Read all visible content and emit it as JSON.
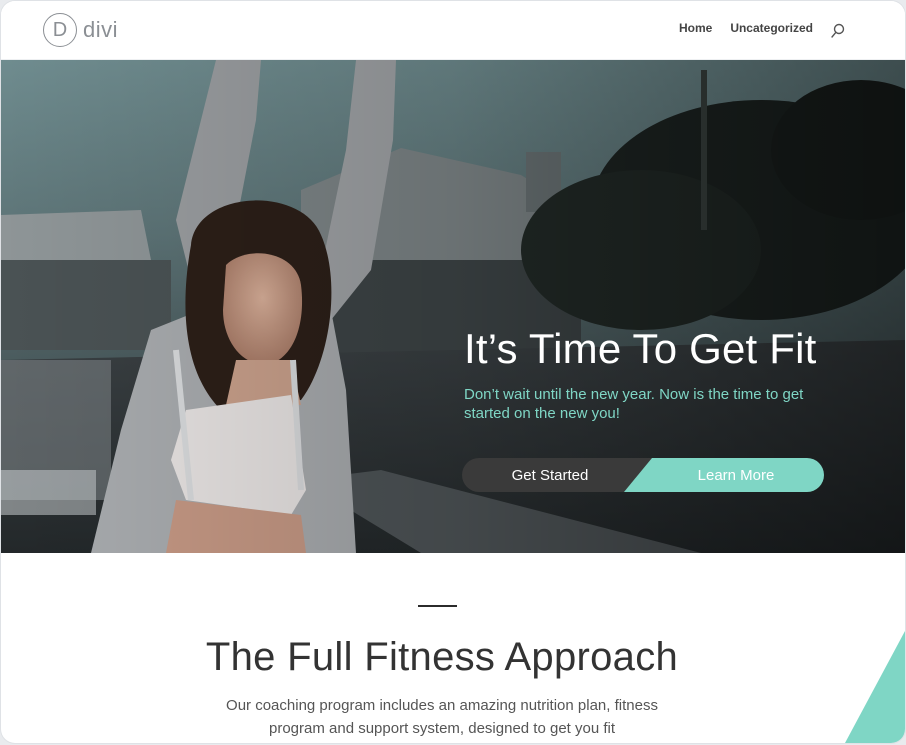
{
  "brand": {
    "logo_letter": "D",
    "name": "divi"
  },
  "nav": {
    "items": [
      {
        "label": "Home"
      },
      {
        "label": "Uncategorized"
      }
    ],
    "search_icon": "search-icon"
  },
  "hero": {
    "title": "It’s Time To Get Fit",
    "subtitle": "Don’t wait until the new year. Now is the time to get started on the new you!",
    "primary_button": "Get Started",
    "secondary_button": "Learn More"
  },
  "section": {
    "title": "The Full Fitness Approach",
    "body": "Our coaching program includes an amazing nutrition plan, fitness program and support system, designed to get you fit"
  },
  "colors": {
    "accent": "#7fd6c5",
    "dark_button": "#3a3a3a",
    "text_dark": "#333333"
  }
}
